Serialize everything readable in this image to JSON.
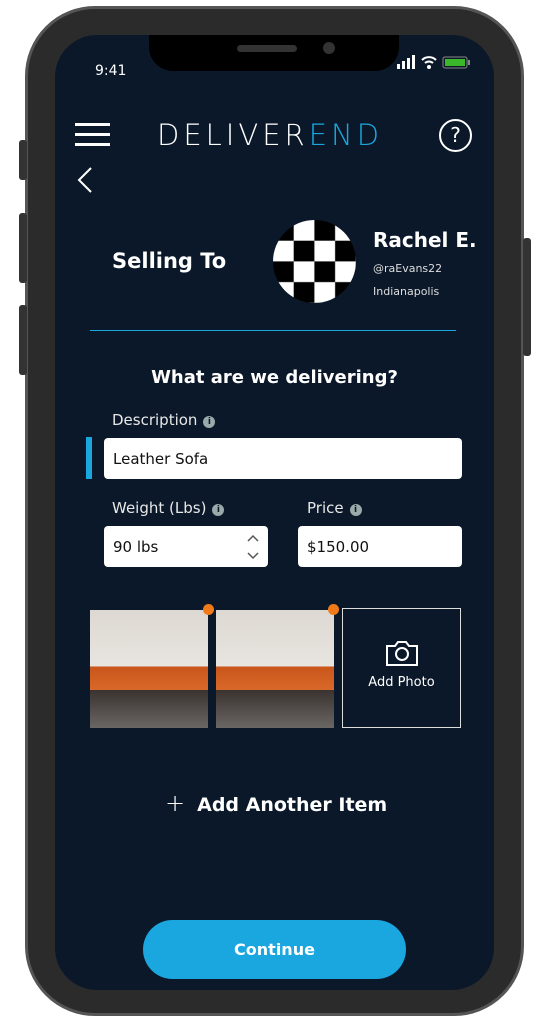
{
  "status": {
    "time": "9:41"
  },
  "header": {
    "logo_left": "DELIVER",
    "logo_right": "END"
  },
  "seller": {
    "label": "Selling To",
    "name": "Rachel E.",
    "handle": "@raEvans22",
    "city": "Indianapolis"
  },
  "form": {
    "heading": "What are we delivering?",
    "description_label": "Description",
    "description_value": "Leather Sofa",
    "weight_label": "Weight (Lbs)",
    "weight_value": "90 lbs",
    "price_label": "Price",
    "price_value": "$150.00",
    "add_photo": "Add Photo",
    "add_item": "Add Another Item"
  },
  "continue_label": "Continue",
  "colors": {
    "accent": "#1aa7e0",
    "background": "#0b1829",
    "battery": "#3ab82a",
    "remove": "#f07a1a"
  }
}
